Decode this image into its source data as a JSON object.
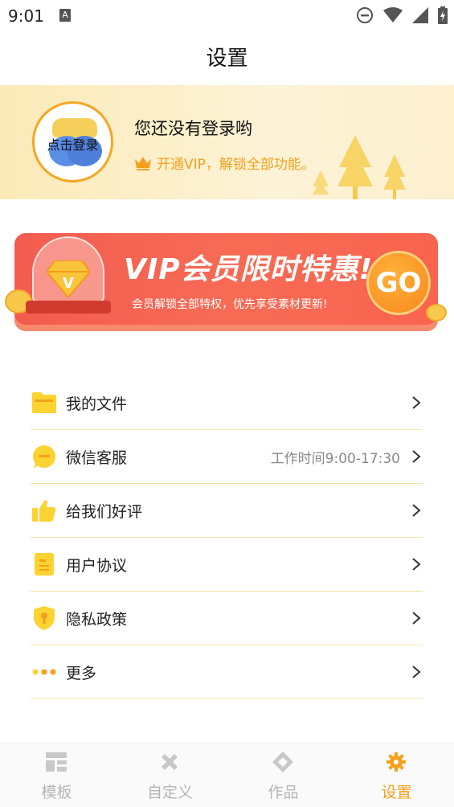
{
  "status_bar": {
    "time": "9:01",
    "notification_glyph": "A",
    "icons": [
      "do-not-disturb-icon",
      "wifi-icon",
      "signal-icon",
      "battery-icon"
    ]
  },
  "page": {
    "title": "设置"
  },
  "profile": {
    "avatar_label": "点击登录",
    "name": "您还没有登录哟",
    "vip_text": "开通VIP，解锁全部功能。",
    "accent_color": "#f5a01c"
  },
  "vip_banner": {
    "title": "VIP会员限时特惠!",
    "subtitle": "会员解锁全部特权，优先享受素材更新!",
    "go_label": "GO",
    "gem_letter": "V"
  },
  "menu": {
    "items": [
      {
        "label": "我的文件",
        "icon": "folder-icon",
        "extra": ""
      },
      {
        "label": "微信客服",
        "icon": "chat-icon",
        "extra": "工作时间9:00-17:30"
      },
      {
        "label": "给我们好评",
        "icon": "thumbs-up-icon",
        "extra": ""
      },
      {
        "label": "用户协议",
        "icon": "document-icon",
        "extra": ""
      },
      {
        "label": "隐私政策",
        "icon": "shield-icon",
        "extra": ""
      },
      {
        "label": "更多",
        "icon": "more-dots-icon",
        "extra": ""
      }
    ]
  },
  "bottom_nav": {
    "items": [
      {
        "label": "模板",
        "icon": "template-icon",
        "active": false
      },
      {
        "label": "自定义",
        "icon": "tools-icon",
        "active": false
      },
      {
        "label": "作品",
        "icon": "works-icon",
        "active": false
      },
      {
        "label": "设置",
        "icon": "gear-icon",
        "active": true
      }
    ],
    "active_color": "#f5a01c",
    "inactive_color": "#b5b5b5"
  }
}
